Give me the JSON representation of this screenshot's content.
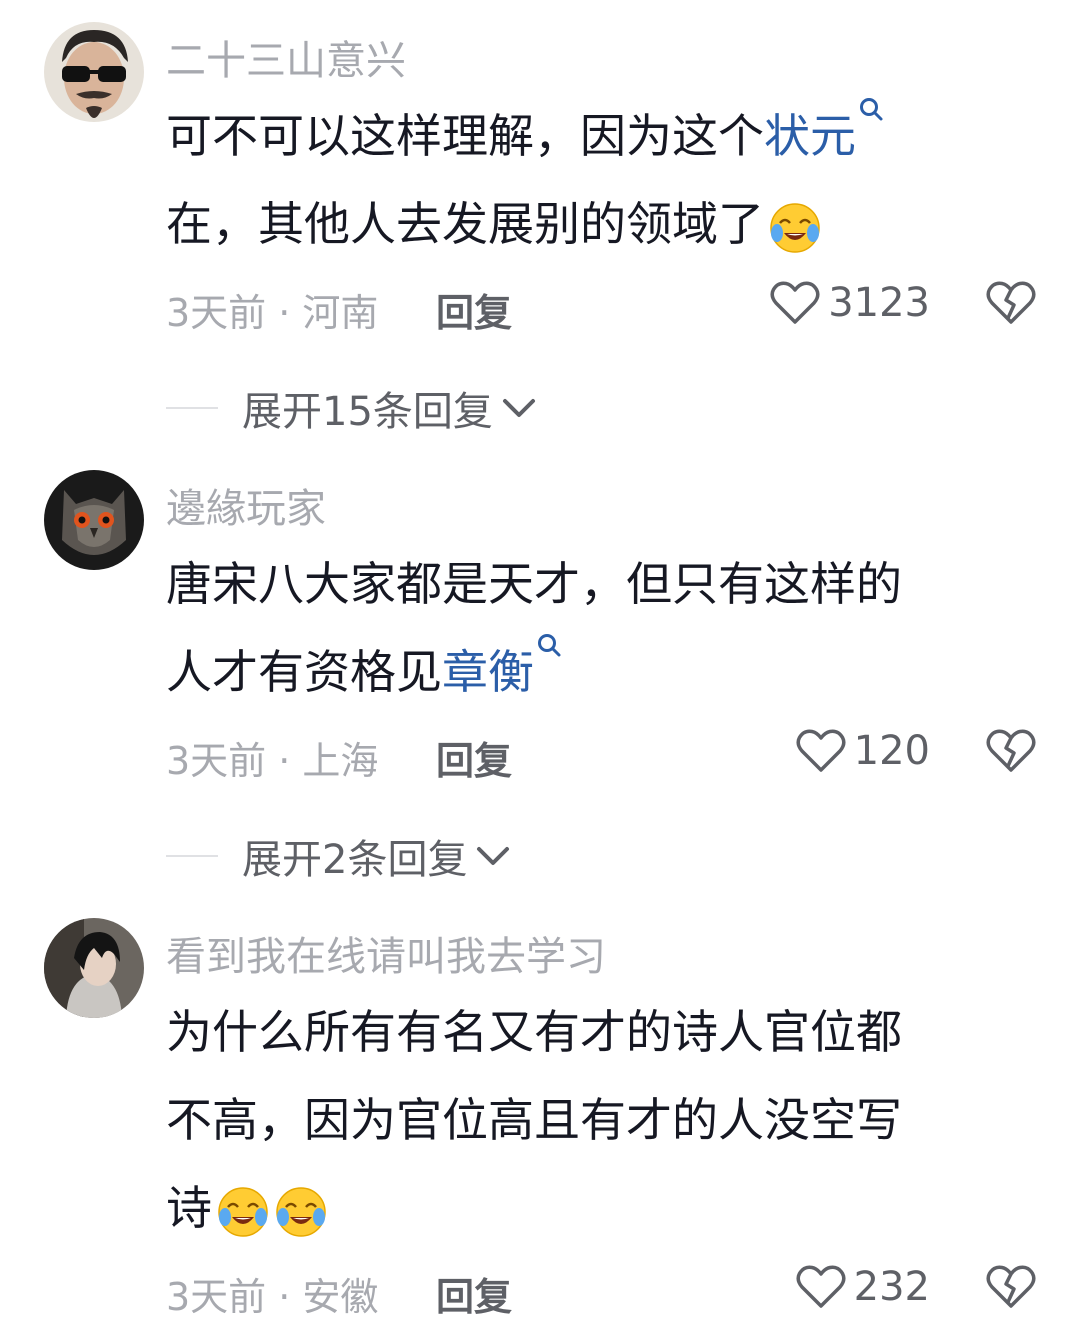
{
  "comments": [
    {
      "username": "二十三山意兴",
      "lines": [
        "可不可以这样理解，因为这个",
        "在，其他人去发展别的领域了"
      ],
      "keyword": "状元",
      "time_location": "3天前 · 河南",
      "reply_label": "回复",
      "likes": "3123",
      "expand_label": "展开15条回复"
    },
    {
      "username": "邊緣玩家",
      "lines": [
        "唐宋八大家都是天才，但只有这样的",
        "人才有资格见"
      ],
      "keyword": "章衡",
      "time_location": "3天前 · 上海",
      "reply_label": "回复",
      "likes": "120",
      "expand_label": "展开2条回复"
    },
    {
      "username": "看到我在线请叫我去学习",
      "lines": [
        "为什么所有有名又有才的诗人官位都",
        "不高，因为官位高且有才的人没空写",
        "诗"
      ],
      "time_location": "3天前 · 安徽",
      "reply_label": "回复",
      "likes": "232"
    }
  ],
  "icons": {
    "like": "heart-outline-icon",
    "dislike": "broken-heart-icon",
    "expand": "chevron-down-icon",
    "search": "search-icon",
    "emoji": "crying-laughing-emoji"
  },
  "colors": {
    "keyword": "#2b5ea8",
    "secondary_text": "#a7a9af",
    "primary_text": "#161823"
  }
}
